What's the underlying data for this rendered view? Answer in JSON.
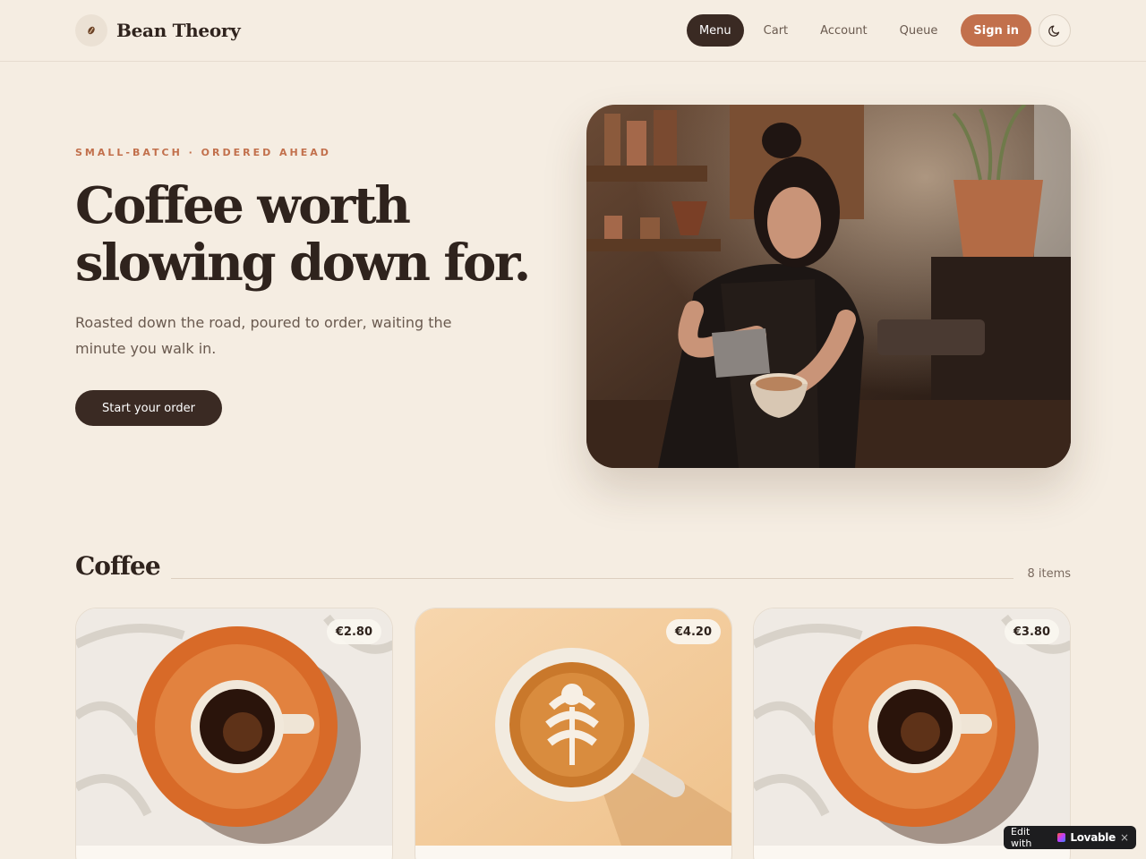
{
  "brand": {
    "name": "Bean Theory",
    "icon": "coffee-bean-icon"
  },
  "nav": {
    "items": [
      {
        "label": "Menu",
        "active": true
      },
      {
        "label": "Cart",
        "active": false
      },
      {
        "label": "Account",
        "active": false
      },
      {
        "label": "Queue",
        "active": false
      }
    ],
    "signin_label": "Sign in",
    "theme_icon": "moon-icon"
  },
  "hero": {
    "eyebrow": "SMALL-BATCH · ORDERED AHEAD",
    "title_line1": "Coffee worth",
    "title_line2": "slowing down for.",
    "subtitle": "Roasted down the road, poured to order, waiting the minute you walk in.",
    "cta_label": "Start your order"
  },
  "section": {
    "title": "Coffee",
    "count": "8 items"
  },
  "products": [
    {
      "price": "€2.80"
    },
    {
      "price": "€4.20"
    },
    {
      "price": "€3.80"
    }
  ],
  "badge": {
    "prefix": "Edit with",
    "brand": "Lovable",
    "close": "×"
  },
  "colors": {
    "background": "#f5ede2",
    "accent": "#c2704c",
    "dark": "#3a2a23"
  }
}
